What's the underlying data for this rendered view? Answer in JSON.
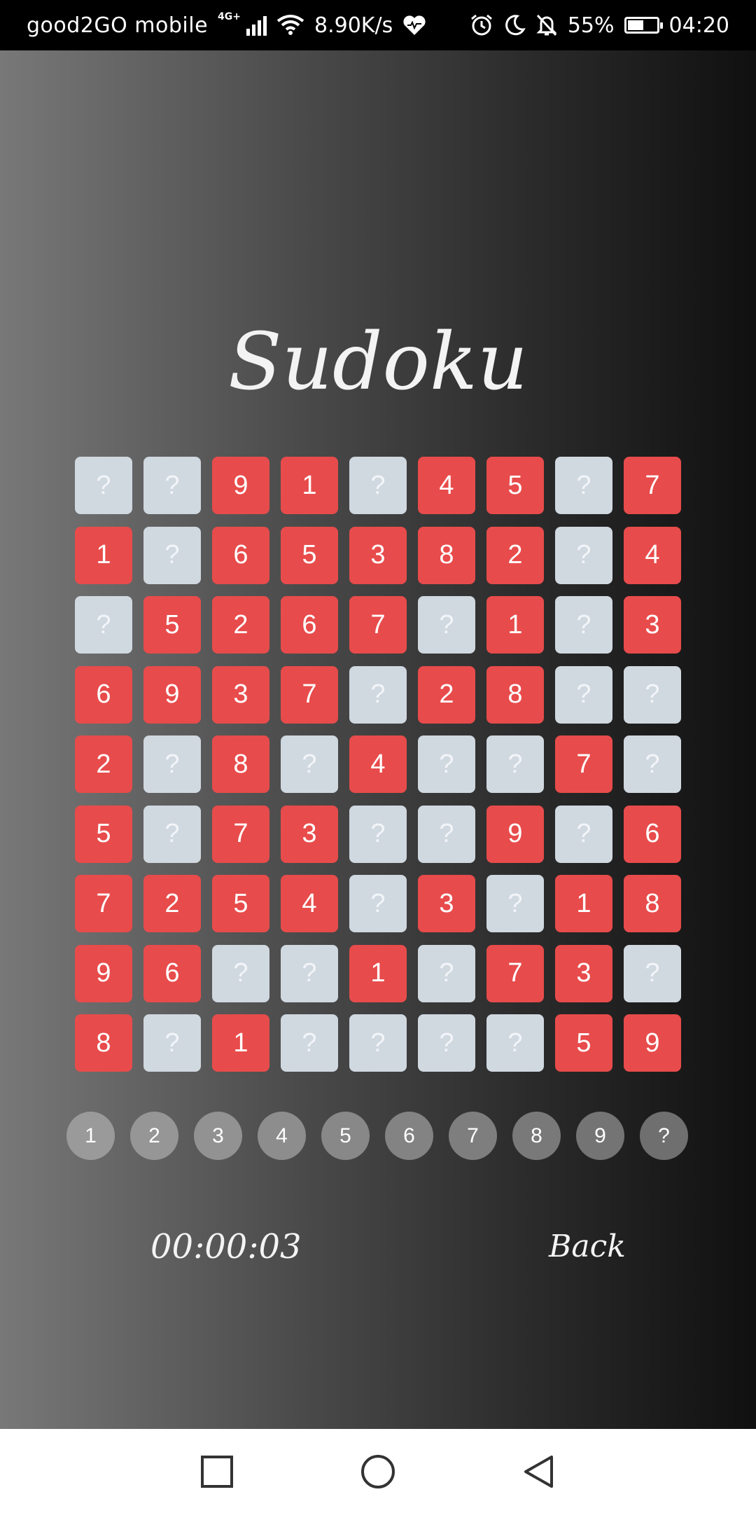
{
  "status_bar": {
    "carrier": "good2GO mobile",
    "network_type": "4G+",
    "speed": "8.90K/s",
    "battery_percent": "55%",
    "battery_level": 0.55,
    "time": "04:20"
  },
  "app": {
    "title": "Sudoku",
    "timer": "00:00:03",
    "back_label": "Back"
  },
  "colors": {
    "given_cell": "#e84b4b",
    "empty_cell": "#d0d8e0"
  },
  "board": [
    [
      "?",
      "?",
      "9",
      "1",
      "?",
      "4",
      "5",
      "?",
      "7"
    ],
    [
      "1",
      "?",
      "6",
      "5",
      "3",
      "8",
      "2",
      "?",
      "4"
    ],
    [
      "?",
      "5",
      "2",
      "6",
      "7",
      "?",
      "1",
      "?",
      "3"
    ],
    [
      "6",
      "9",
      "3",
      "7",
      "?",
      "2",
      "8",
      "?",
      "?"
    ],
    [
      "2",
      "?",
      "8",
      "?",
      "4",
      "?",
      "?",
      "7",
      "?"
    ],
    [
      "5",
      "?",
      "7",
      "3",
      "?",
      "?",
      "9",
      "?",
      "6"
    ],
    [
      "7",
      "2",
      "5",
      "4",
      "?",
      "3",
      "?",
      "1",
      "8"
    ],
    [
      "9",
      "6",
      "?",
      "?",
      "1",
      "?",
      "7",
      "3",
      "?"
    ],
    [
      "8",
      "?",
      "1",
      "?",
      "?",
      "?",
      "?",
      "5",
      "9"
    ]
  ],
  "number_picker": [
    "1",
    "2",
    "3",
    "4",
    "5",
    "6",
    "7",
    "8",
    "9",
    "?"
  ],
  "picker_colors": [
    "#9a9a9a",
    "#969696",
    "#929292",
    "#8d8d8d",
    "#888888",
    "#838383",
    "#7e7e7e",
    "#797979",
    "#747474",
    "#6f6f6f"
  ],
  "nav_icons": [
    "recents-icon",
    "home-icon",
    "back-icon"
  ]
}
